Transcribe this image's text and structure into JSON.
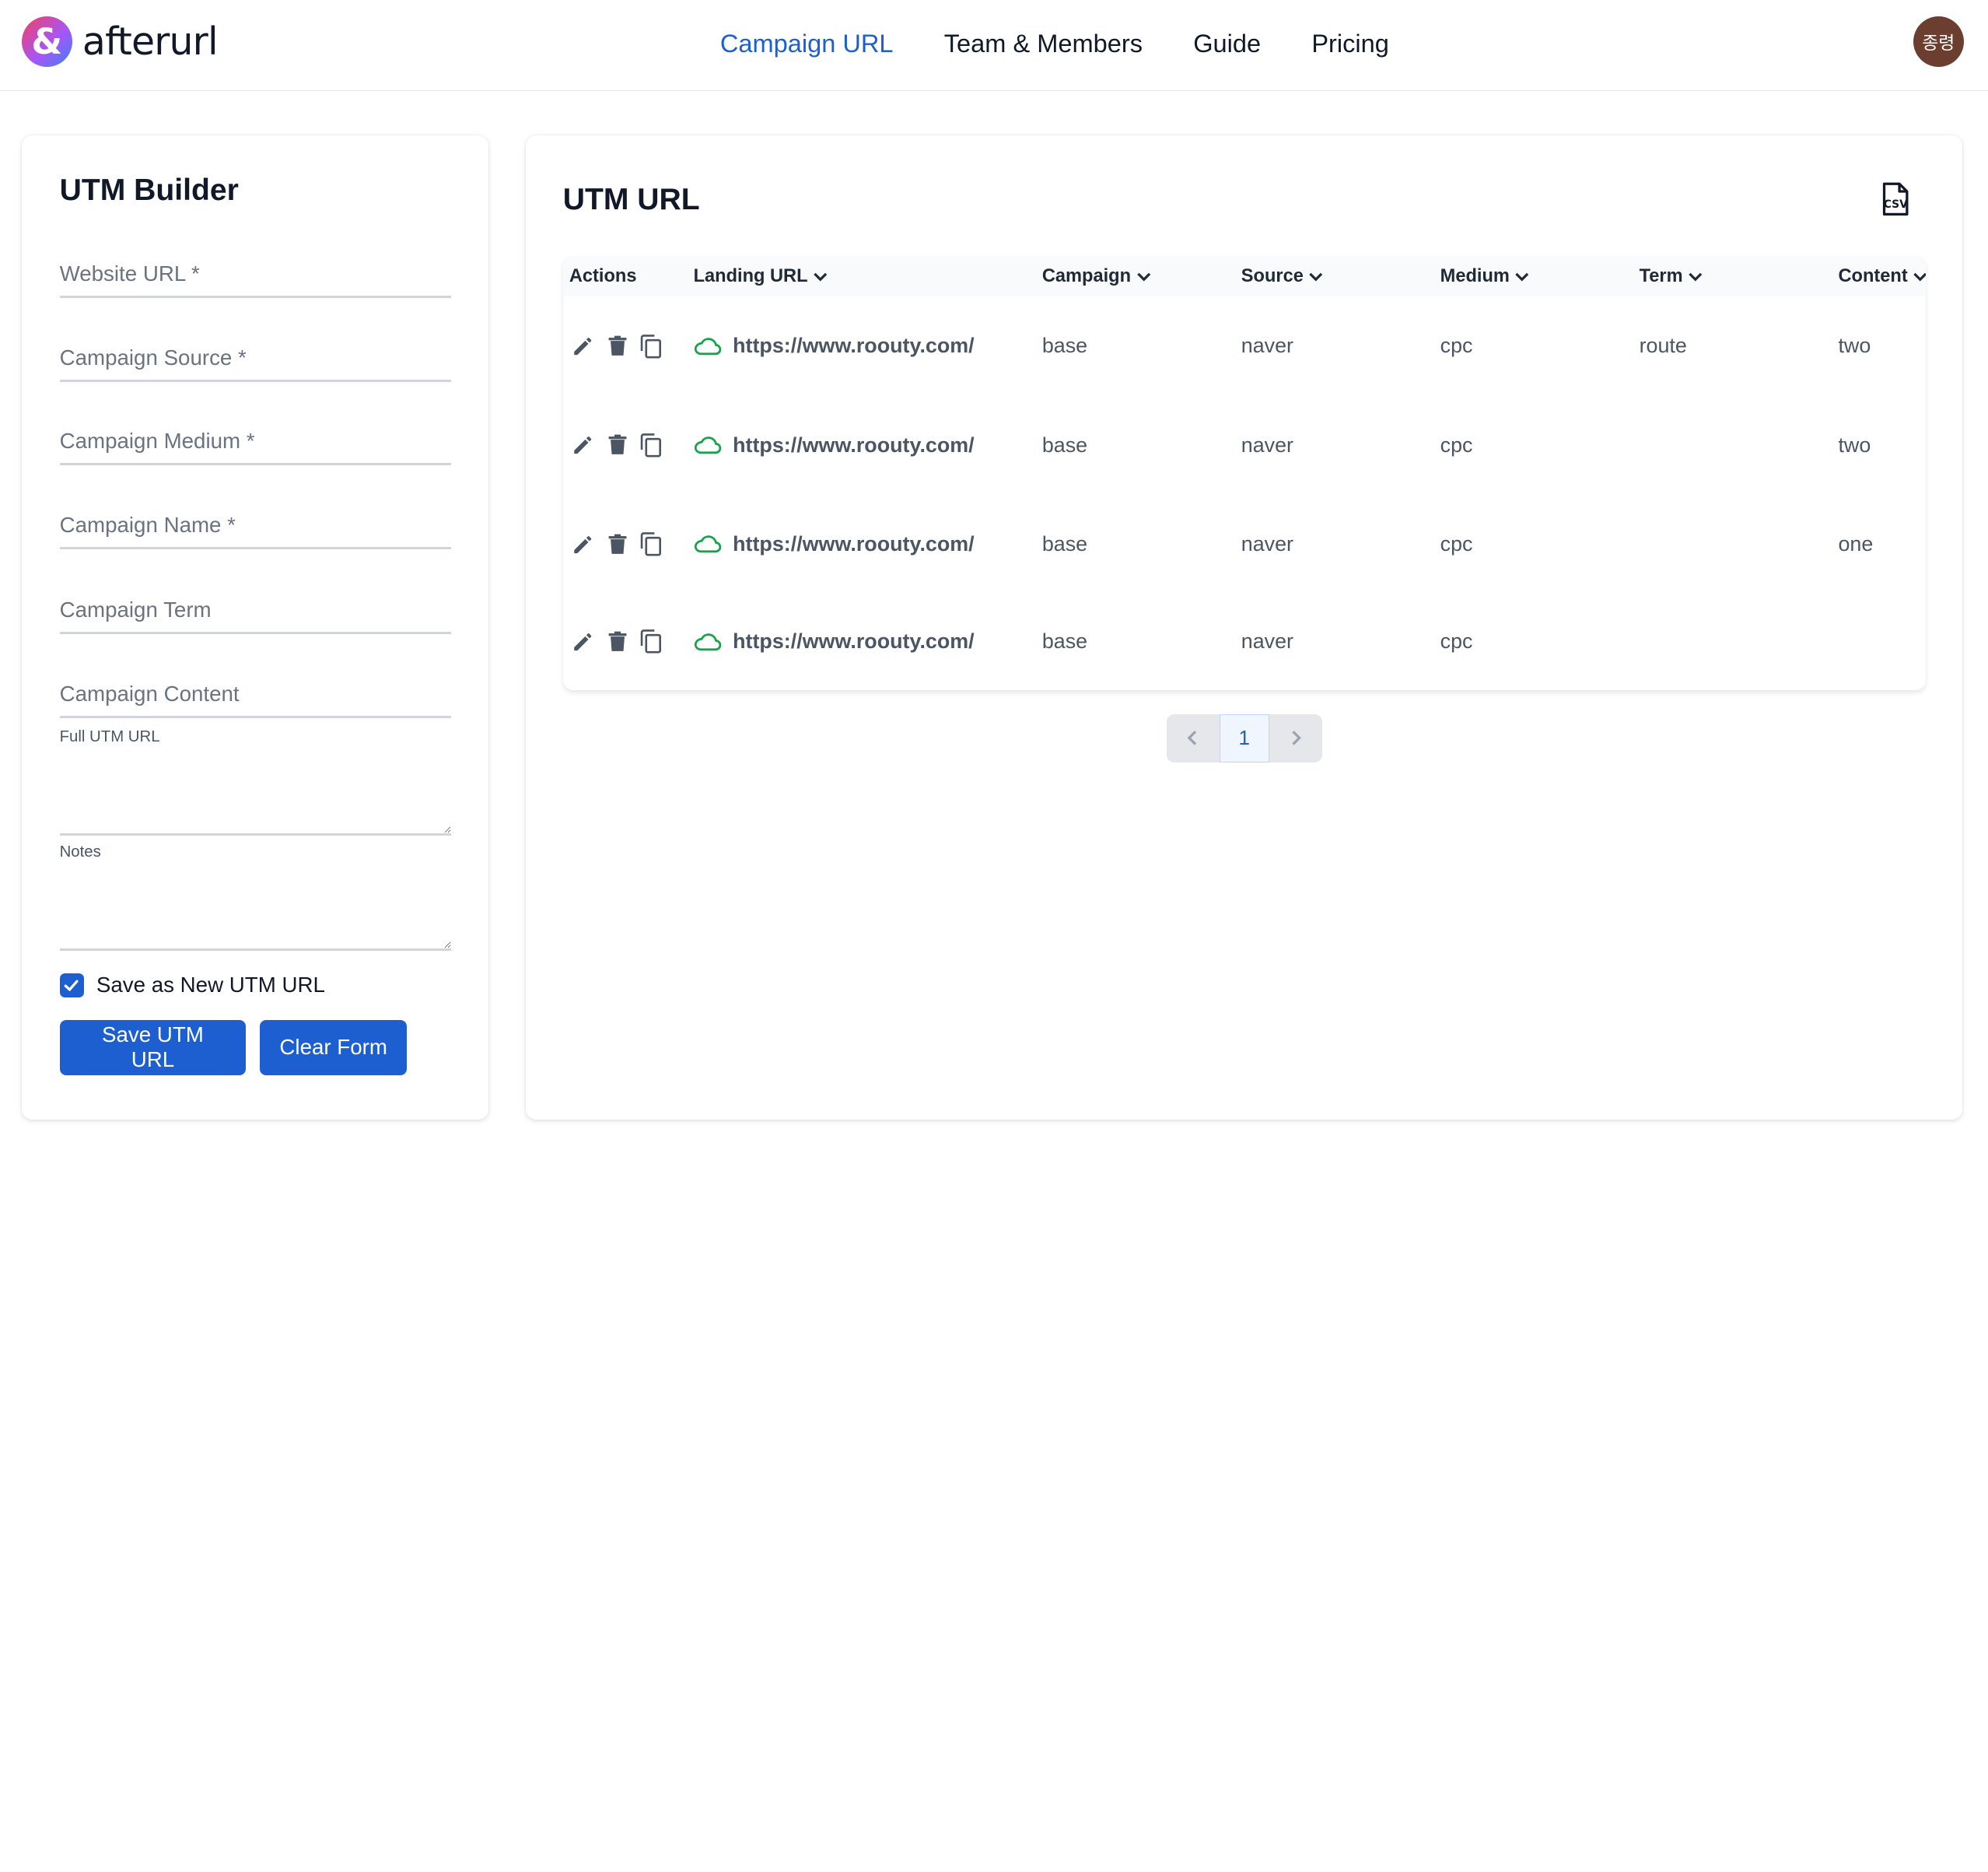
{
  "header": {
    "logo_glyph": "&",
    "brand": "afterurl",
    "nav": [
      {
        "label": "Campaign URL",
        "active": true
      },
      {
        "label": "Team & Members",
        "active": false
      },
      {
        "label": "Guide",
        "active": false
      },
      {
        "label": "Pricing",
        "active": false
      }
    ],
    "avatar_text": "종령"
  },
  "builder": {
    "title": "UTM Builder",
    "fields": {
      "website_url": {
        "placeholder": "Website URL *",
        "value": ""
      },
      "source": {
        "placeholder": "Campaign Source *",
        "value": ""
      },
      "medium": {
        "placeholder": "Campaign Medium *",
        "value": ""
      },
      "name": {
        "placeholder": "Campaign Name *",
        "value": ""
      },
      "term": {
        "placeholder": "Campaign Term",
        "value": ""
      },
      "content": {
        "placeholder": "Campaign Content",
        "value": ""
      }
    },
    "full_url_label": "Full UTM URL",
    "notes_label": "Notes",
    "save_new_label": "Save as New UTM URL",
    "save_new_checked": true,
    "save_button": "Save UTM URL",
    "clear_button": "Clear Form"
  },
  "utm_table": {
    "title": "UTM URL",
    "export_icon": "csv-file-icon",
    "columns": {
      "actions": "Actions",
      "landing": "Landing URL",
      "campaign": "Campaign",
      "source": "Source",
      "medium": "Medium",
      "term": "Term",
      "content": "Content"
    },
    "rows": [
      {
        "landing": "https://www.roouty.com/",
        "campaign": "base",
        "source": "naver",
        "medium": "cpc",
        "term": "route",
        "content": "two"
      },
      {
        "landing": "https://www.roouty.com/",
        "campaign": "base",
        "source": "naver",
        "medium": "cpc",
        "term": "",
        "content": "two"
      },
      {
        "landing": "https://www.roouty.com/",
        "campaign": "base",
        "source": "naver",
        "medium": "cpc",
        "term": "",
        "content": "one"
      },
      {
        "landing": "https://www.roouty.com/",
        "campaign": "base",
        "source": "naver",
        "medium": "cpc",
        "term": "",
        "content": ""
      }
    ],
    "pagination": {
      "current": "1"
    }
  },
  "colors": {
    "primary": "#1d5fd1",
    "cloud_icon": "#16a34a",
    "avatar_bg": "#6b3e30"
  }
}
